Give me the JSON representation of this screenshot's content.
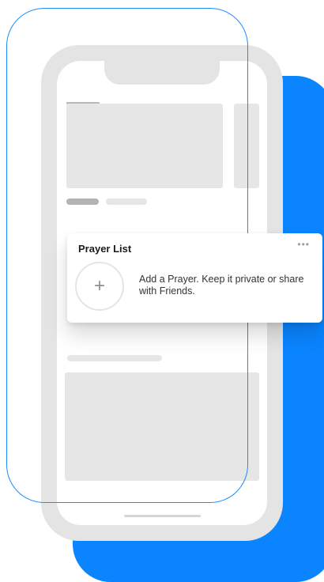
{
  "prayer_card": {
    "title": "Prayer List",
    "more_icon": "•••",
    "add_icon": "+",
    "description": "Add a Prayer. Keep it private or share with Friends."
  },
  "colors": {
    "accent_blue": "#0a84ff",
    "outline_blue": "#1a8cff",
    "phone_gray": "#e4e4e4",
    "placeholder_gray": "#e6e6e6"
  },
  "icons": {
    "more": "more-horizontal-icon",
    "add": "plus-icon"
  }
}
